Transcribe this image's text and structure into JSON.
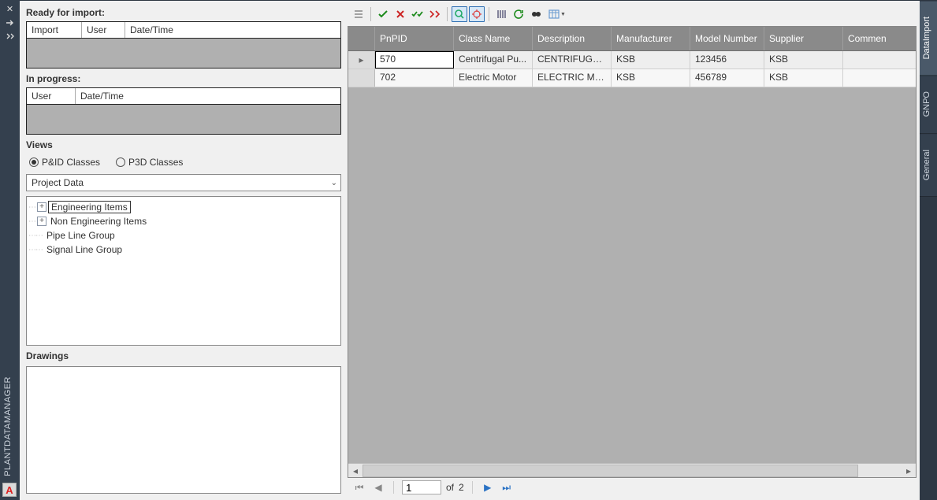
{
  "titlebar": {
    "name": "PLANTDATAMANAGER",
    "logo_letter": "A"
  },
  "right_tabs": [
    "DataImport",
    "GNPO",
    "General"
  ],
  "left": {
    "ready_label": "Ready for import:",
    "ready_cols": [
      "Import",
      "User",
      "Date/Time"
    ],
    "inprogress_label": "In progress:",
    "inprogress_cols": [
      "User",
      "Date/Time"
    ],
    "views_label": "Views",
    "radios": {
      "pid": "P&ID Classes",
      "p3d": "P3D Classes"
    },
    "dropdown_value": "Project Data",
    "tree": [
      {
        "expand": true,
        "label": "Engineering Items",
        "selected": true
      },
      {
        "expand": true,
        "label": "Non Engineering Items",
        "selected": false
      },
      {
        "expand": false,
        "label": "Pipe Line Group",
        "selected": false
      },
      {
        "expand": false,
        "label": "Signal Line Group",
        "selected": false
      }
    ],
    "drawings_label": "Drawings"
  },
  "grid": {
    "columns": [
      "PnPID",
      "Class Name",
      "Description",
      "Manufacturer",
      "Model Number",
      "Supplier",
      "Commen"
    ],
    "rows": [
      {
        "pnpid": "570",
        "class": "Centrifugal Pu...",
        "desc": "CENTRIFUGAL ...",
        "mfr": "KSB",
        "model": "123456",
        "supp": "KSB",
        "comm": ""
      },
      {
        "pnpid": "702",
        "class": "Electric Motor",
        "desc": "ELECTRIC MOT...",
        "mfr": "KSB",
        "model": "456789",
        "supp": "KSB",
        "comm": ""
      }
    ]
  },
  "pager": {
    "current": "1",
    "of_label": "of",
    "total": "2"
  }
}
